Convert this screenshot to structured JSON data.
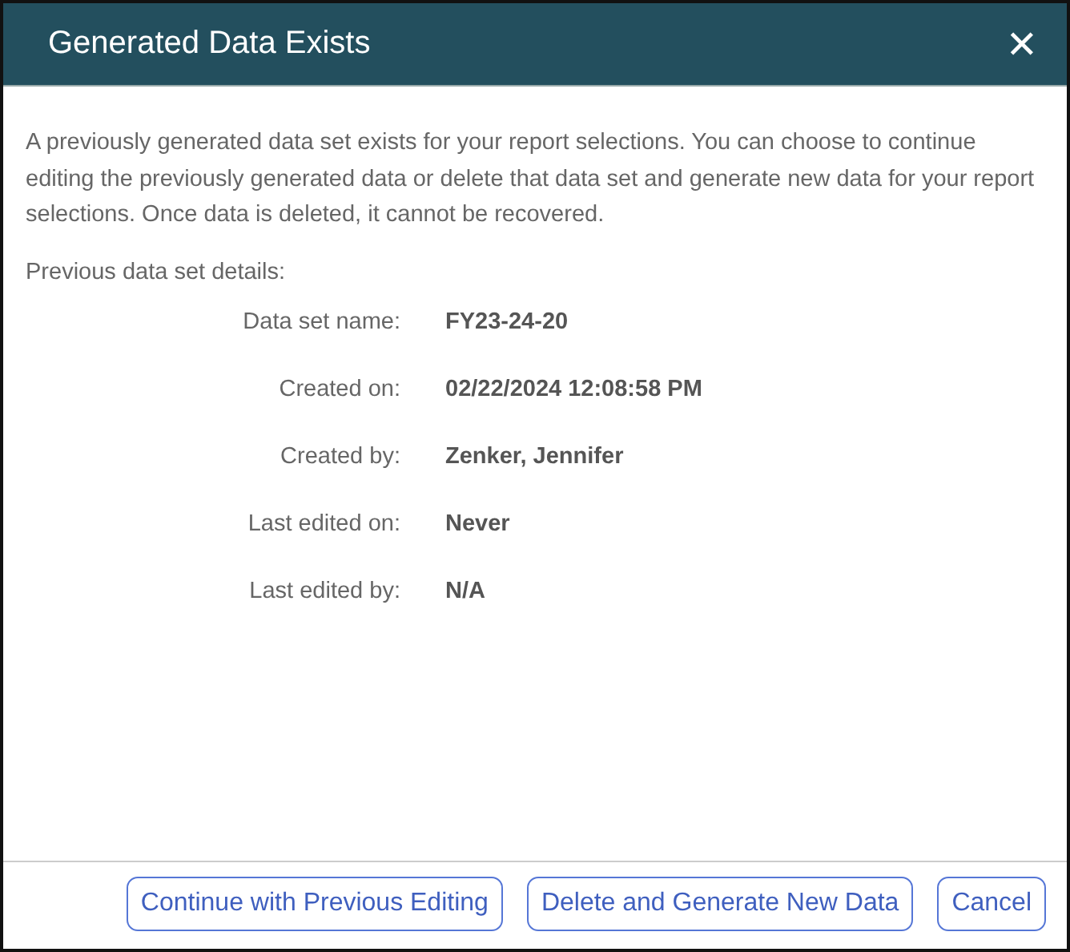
{
  "dialog": {
    "title": "Generated Data Exists",
    "close": "✕",
    "message": "A previously generated data set exists for your report selections. You can choose to continue editing the previously generated data or delete that data set and generate new data for your report selections. Once data is deleted, it cannot be recovered.",
    "details_heading": "Previous data set details:",
    "details": [
      {
        "label": "Data set name:",
        "value": "FY23-24-20"
      },
      {
        "label": "Created on:",
        "value": "02/22/2024 12:08:58 PM"
      },
      {
        "label": "Created by:",
        "value": "Zenker, Jennifer"
      },
      {
        "label": "Last edited on:",
        "value": "Never"
      },
      {
        "label": "Last edited by:",
        "value": "N/A"
      }
    ],
    "buttons": [
      "Continue with Previous Editing",
      "Delete and Generate New Data",
      "Cancel"
    ]
  }
}
